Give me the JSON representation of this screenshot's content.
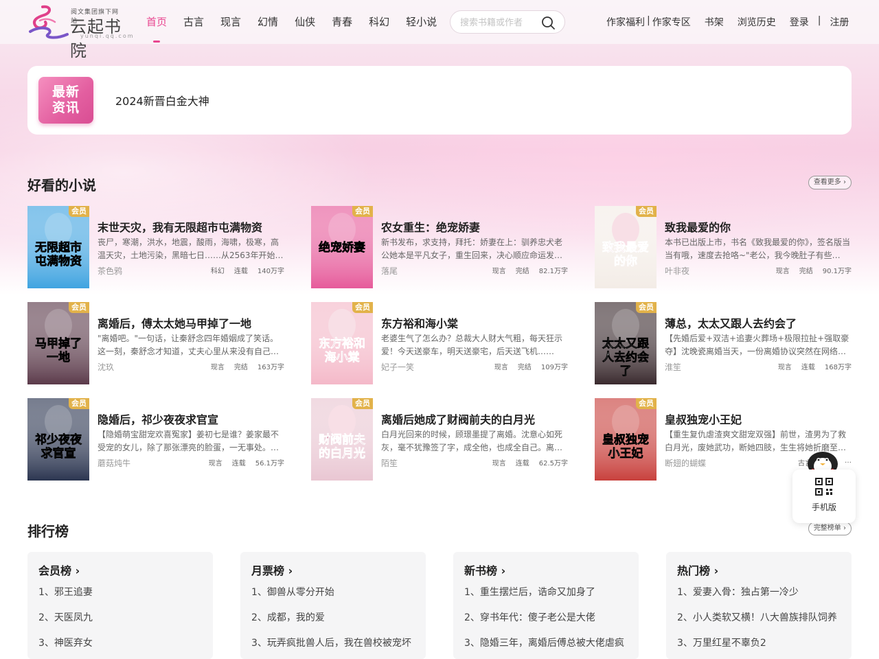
{
  "header": {
    "logo": {
      "subtitle": "阅文集团旗下网站",
      "main": "云起书院",
      "url": "yunqi.qq.com"
    },
    "nav": [
      "首页",
      "古言",
      "现言",
      "幻情",
      "仙侠",
      "青春",
      "科幻",
      "轻小说"
    ],
    "active_nav": 0,
    "search": {
      "placeholder": "搜索书籍或作者"
    },
    "links": {
      "author_welfare": "作家福利",
      "divider": "|",
      "author_zone": "作家专区",
      "bookshelf": "书架",
      "history": "浏览历史",
      "login": "登录",
      "divider2": "|",
      "register": "注册"
    }
  },
  "news": {
    "badge_line1": "最新",
    "badge_line2": "资讯",
    "text": "2024新晋白金大神"
  },
  "good_novels": {
    "title": "好看的小说",
    "more": "查看更多 ›",
    "vip_label": "会员",
    "books": [
      {
        "title": "末世天灾，我有无限超市屯满物资",
        "desc": "丧尸，寒潮，洪水，地震，酸雨，海啸，极寒，高温天灾，土地污染，黑暗七日……从2563年开始…",
        "author": "茶色鸦",
        "tags": [
          "科幻",
          "连载",
          "140万字"
        ],
        "cover_text": "无限超市屯满物资",
        "cover_color": "#3fa3e0"
      },
      {
        "title": "农女重生：绝宠娇妻",
        "desc": "新书发布，求支持，拜托：娇妻在上：驯养忠犬老公她本是平凡女子，重生回来，决心顺应命运发…",
        "author": "落尾",
        "tags": [
          "现言",
          "完结",
          "82.1万字"
        ],
        "cover_text": "绝宠娇妻",
        "cover_color": "#e65a9a"
      },
      {
        "title": "致我最爱的你",
        "desc": "本书已出版上市，书名《致我最爱的你》，签名版当当有哦，速度去抢咯~\"老公，我今晚肚子有些…",
        "author": "叶非夜",
        "tags": [
          "现言",
          "完结",
          "90.1万字"
        ],
        "cover_text": "致我最爱的你",
        "cover_color": "#f3ece6"
      },
      {
        "title": "离婚后，傅太太她马甲掉了一地",
        "desc": "\"离婚吧。\"一句话，让秦舒念四年婚姻成了笑话。这一刻，秦舒念才知道，丈夫心里从来没有自己…",
        "author": "沈玖",
        "tags": [
          "现言",
          "完结",
          "163万字"
        ],
        "cover_text": "马甲掉了一地",
        "cover_color": "#5b3a4a"
      },
      {
        "title": "东方裕和海小棠",
        "desc": "老婆生气了怎么办？总裁大人财大气粗，每天狂示爱！今天送豪车，明天送豪宅，后天送飞机……",
        "author": "妃子一笑",
        "tags": [
          "现言",
          "完结",
          "109万字"
        ],
        "cover_text": "东方裕和海小棠",
        "cover_color": "#f4b8c8"
      },
      {
        "title": "薄总，太太又跟人去约会了",
        "desc": "【先婚后爱+双洁+追妻火葬场+极限拉扯+强取豪夺】沈晚瓷离婚当天，一份离婚协议突然在网络…",
        "author": "淮笙",
        "tags": [
          "现言",
          "连载",
          "168万字"
        ],
        "cover_text": "太太又跟人去约会了",
        "cover_color": "#3a2a2e"
      },
      {
        "title": "隐婚后，祁少夜夜求官宣",
        "desc": "【隐婚萌宝甜宠欢喜冤家】姜初七是谁？姜家最不受宠的女儿，除了那张漂亮的脸蛋，一无事处。…",
        "author": "蘑菇炖牛",
        "tags": [
          "现言",
          "连载",
          "56.1万字"
        ],
        "cover_text": "祁少夜夜求官宣",
        "cover_color": "#2b3550"
      },
      {
        "title": "离婚后她成了财阀前夫的白月光",
        "desc": "白月光回来的时候，顾璟墨提了离婚。沈意心如死灰，毫不犹豫签了字，成全他，也成全自己。离…",
        "author": "陌笙",
        "tags": [
          "现言",
          "连载",
          "62.5万字"
        ],
        "cover_text": "财阀前夫的白月光",
        "cover_color": "#e9c6d2"
      },
      {
        "title": "皇叔独宠小王妃",
        "desc": "【重生复仇虐渣爽文甜宠双强】前世，渣男为了救白月光，废她武功，断她四肢，生生将她折磨至…",
        "author": "断翅的蝴蝶",
        "tags": [
          "古言",
          "完结",
          "…"
        ],
        "cover_text": "皇叔独宠小王妃",
        "cover_color": "#c8403c"
      }
    ]
  },
  "ranking": {
    "title": "排行榜",
    "more": "完整榜单 ›",
    "lists": [
      {
        "name": "会员榜 ›",
        "items": [
          "1、邪王追妻",
          "2、天医凤九",
          "3、神医弃女"
        ]
      },
      {
        "name": "月票榜 ›",
        "items": [
          "1、御兽从零分开始",
          "2、成都，我的爱",
          "3、玩弄疯批兽人后，我在兽校被宠坏"
        ]
      },
      {
        "name": "新书榜 ›",
        "items": [
          "1、重生摆烂后，诰命又加身了",
          "2、穿书年代：傻子老公是大佬",
          "3、隐婚三年，离婚后傅总被大佬虐疯"
        ]
      },
      {
        "name": "热门榜 ›",
        "items": [
          "1、爱妻入骨：独占第一冷少",
          "2、小人类软又横！八大兽族排队饲养",
          "3、万里红星不辜负2"
        ]
      }
    ]
  },
  "mobile": {
    "label": "手机版"
  },
  "colors": {
    "accent": "#e8458f",
    "vip": "#e2b24a",
    "rank_bg": "#f5f5f6"
  }
}
